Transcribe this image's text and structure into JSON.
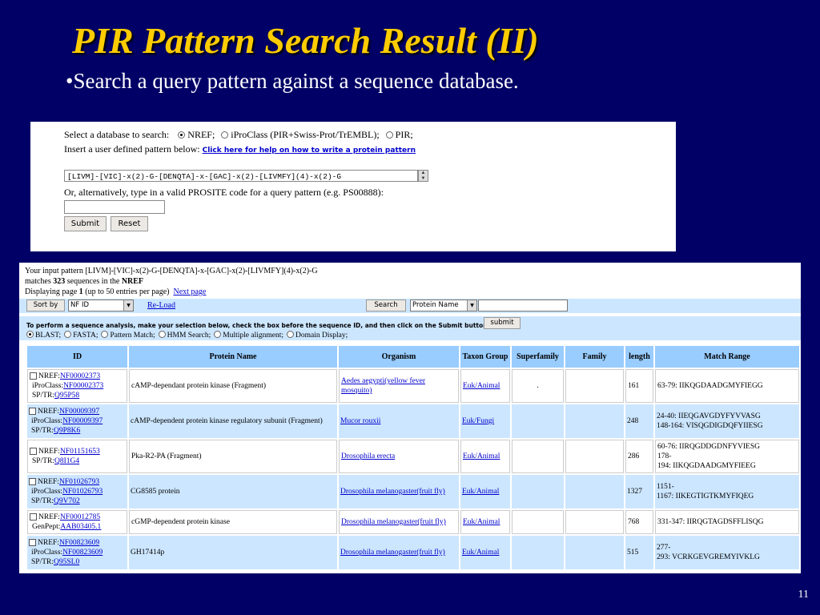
{
  "slide": {
    "title": "PIR Pattern Search Result (II)",
    "bullet": "•Search a query pattern against a sequence database.",
    "page_number": "11"
  },
  "search_form": {
    "select_label": "Select a database to search:",
    "db_options": [
      {
        "label": "NREF;",
        "selected": true
      },
      {
        "label": "iProClass (PIR+Swiss-Prot/TrEMBL);",
        "selected": false
      },
      {
        "label": "PIR;",
        "selected": false
      }
    ],
    "insert_label": "Insert a user defined pattern below:",
    "help_link": "Click here for help on how to write a protein pattern",
    "pattern_value": "[LIVM]-[VIC]-x(2)-G-[DENQTA]-x-[GAC]-x(2)-[LIVMFY](4)-x(2)-G",
    "prosite_label": "Or, alternatively, type in a valid PROSITE code for a query pattern (e.g. PS00888):",
    "prosite_value": "",
    "submit_label": "Submit",
    "reset_label": "Reset"
  },
  "results": {
    "input_pattern_prefix": "Your input pattern",
    "input_pattern": "[LIVM]-[VIC]-x(2)-G-[DENQTA]-x-[GAC]-x(2)-[LIVMFY](4)-x(2)-G",
    "matches_prefix": "matches",
    "match_count": "323",
    "matches_mid": "sequences in the",
    "database": "NREF",
    "displaying_prefix": "Displaying page",
    "page": "1",
    "displaying_suffix": "(up to 50 entries per page)",
    "next_page": "Next page",
    "sort_button": "Sort by",
    "sort_value": "NF ID",
    "reload_link": "Re-Load",
    "search_button": "Search",
    "search_field": "Protein Name",
    "search_value": "",
    "analysis_note": "To perform a sequence analysis, make your selection below, check the box before the sequence ID, and then click on the Submit button.",
    "analysis_submit": "submit",
    "analysis_options": [
      {
        "label": "BLAST;",
        "selected": true
      },
      {
        "label": "FASTA;",
        "selected": false
      },
      {
        "label": "Pattern Match;",
        "selected": false
      },
      {
        "label": "HMM Search;",
        "selected": false
      },
      {
        "label": "Multiple alignment;",
        "selected": false
      },
      {
        "label": "Domain Display;",
        "selected": false
      }
    ],
    "columns": [
      "ID",
      "Protein Name",
      "Organism",
      "Taxon Group",
      "Superfamily",
      "Family",
      "length",
      "Match Range"
    ],
    "rows": [
      {
        "ids": [
          [
            "NREF:",
            "NF00002373"
          ],
          [
            "iProClass:",
            "NF00002373"
          ],
          [
            "SP/TR:",
            "Q95P58"
          ]
        ],
        "protein": "cAMP-dependant protein kinase (Fragment)",
        "organism": "Aedes aegypti(yellow fever mosquito)",
        "taxon": "Euk/Animal",
        "superfamily": ".",
        "family": "",
        "length": "161",
        "match": [
          "63-79: IIKQGDAADGMYFIEGG"
        ]
      },
      {
        "ids": [
          [
            "NREF:",
            "NF00009397"
          ],
          [
            "iProClass:",
            "NF00009397"
          ],
          [
            "SP/TR:",
            "Q9P8K6"
          ]
        ],
        "protein": "cAMP-dependent protein kinase regulatory subunit (Fragment)",
        "organism": "Mucor rouxii",
        "taxon": "Euk/Fungi",
        "superfamily": "",
        "family": "",
        "length": "248",
        "match": [
          "24-40: IIEQGAVGDYFYVVASG",
          "148-164: VISQGDIGDQFYIIESG"
        ]
      },
      {
        "ids": [
          [
            "NREF:",
            "NF01151653"
          ],
          [
            "SP/TR:",
            "Q8I1G4"
          ]
        ],
        "protein": "Pka-R2-PA (Fragment)",
        "organism": "Drosophila erecta",
        "taxon": "Euk/Animal",
        "superfamily": "",
        "family": "",
        "length": "286",
        "match": [
          "60-76: IIRQGDDGDNFYVIESG",
          "178-",
          "194: IIKQGDAADGMYFIEEG"
        ]
      },
      {
        "ids": [
          [
            "NREF:",
            "NF01026793"
          ],
          [
            "iProClass:",
            "NF01026793"
          ],
          [
            "SP/TR:",
            "Q9V702"
          ]
        ],
        "protein": "CG8585 protein",
        "organism": "Drosophila melanogaster(fruit fly)",
        "taxon": "Euk/Animal",
        "superfamily": "",
        "family": "",
        "length": "1327",
        "match": [
          "1151-",
          "1167: IIKEGTIGTKMYFIQEG"
        ]
      },
      {
        "ids": [
          [
            "NREF:",
            "NF00012785"
          ],
          [
            "GenPept:",
            "AAB03405.1"
          ]
        ],
        "protein": "cGMP-dependent protein kinase",
        "organism": "Drosophila melanogaster(fruit fly)",
        "taxon": "Euk/Animal",
        "superfamily": "",
        "family": "",
        "length": "768",
        "match": [
          "331-347: IIRQGTAGDSFFLISQG"
        ]
      },
      {
        "ids": [
          [
            "NREF:",
            "NF00823609"
          ],
          [
            "iProClass:",
            "NF00823609"
          ],
          [
            "SP/TR:",
            "Q95SL0"
          ]
        ],
        "protein": "GH17414p",
        "organism": "Drosophila melanogaster(fruit fly)",
        "taxon": "Euk/Animal",
        "superfamily": "",
        "family": "",
        "length": "515",
        "match": [
          "277-",
          "293: VCRKGEVGREMYIVKLG"
        ]
      }
    ]
  }
}
